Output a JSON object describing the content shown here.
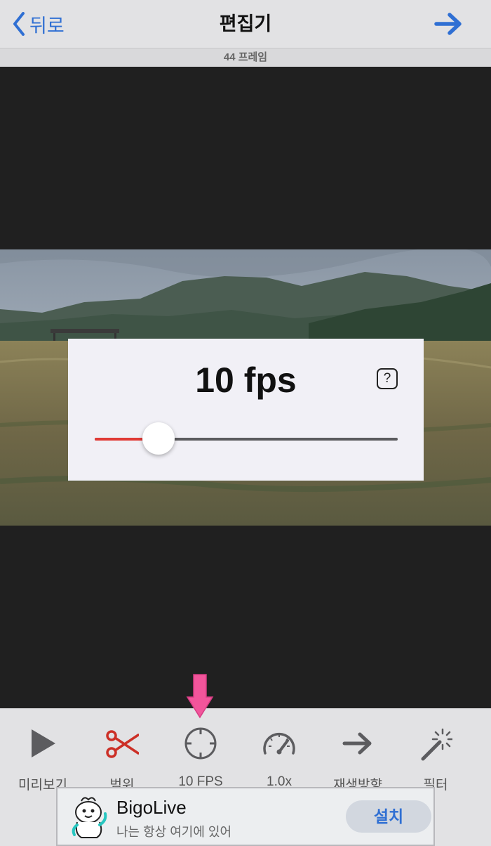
{
  "nav": {
    "back_label": "뒤로",
    "title": "편집기"
  },
  "frame_count": "44 프레임",
  "fps_panel": {
    "value_label": "10 fps",
    "help": "?",
    "slider_fraction": 0.21
  },
  "toolbar": {
    "items": [
      {
        "label": "미리보기",
        "icon": "play-icon"
      },
      {
        "label": "범위",
        "icon": "scissors-icon"
      },
      {
        "label": "10 FPS",
        "icon": "crosshair-icon"
      },
      {
        "label": "1.0x",
        "icon": "speedometer-icon"
      },
      {
        "label": "재생방향",
        "icon": "arrow-right-icon"
      },
      {
        "label": "필터",
        "icon": "magic-wand-icon"
      }
    ]
  },
  "ad": {
    "title": "BigoLive",
    "subtitle": "나는 항상 여기에 있어",
    "button": "설치"
  },
  "colors": {
    "accent": "#2f6fd3",
    "slider_fill": "#e03a35",
    "highlight_arrow": "#f2559b"
  }
}
